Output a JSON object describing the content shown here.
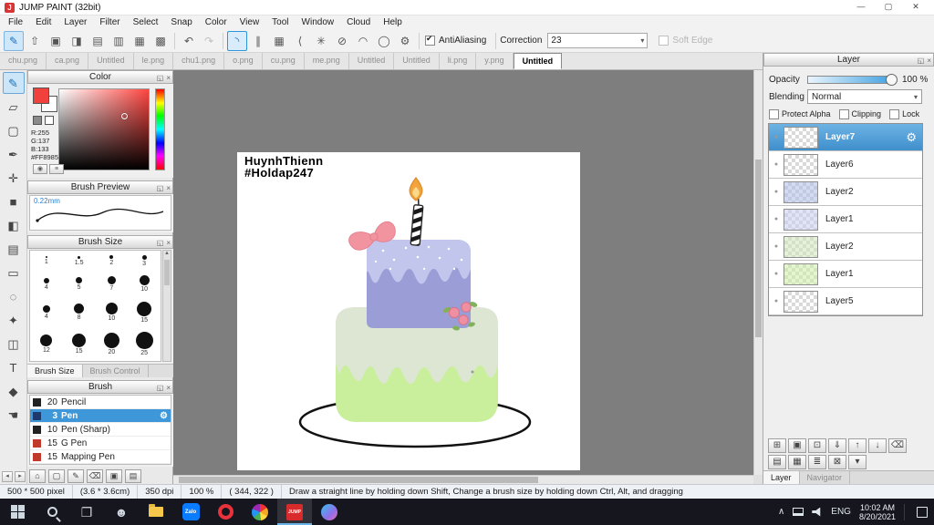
{
  "colors": {
    "accent": "#2f96dc",
    "canvas-bg": "#7e7e7e",
    "taskbar-bg": "#16161f",
    "cake-green": "#c9ef9c",
    "cake-sage": "#dde6d2",
    "cake-lavender": "#9b9ed6",
    "cake-lavender-light": "#c2c5ec",
    "bow-pink": "#f2949f",
    "flame-orange": "#f2a33c",
    "flame-inner": "#fbd98b",
    "rose-pink": "#ee8fa2",
    "leaf-green": "#83b05c",
    "picked-color": "#FF8985"
  },
  "ui": {
    "caret": "▾",
    "gear": "⚙",
    "check": "✔",
    "float_glyph": "◱",
    "close_glyph": "×",
    "eye_dot": "●",
    "scroll_up": "▲",
    "scroll_down": "▼"
  },
  "titlebar": {
    "title": "JUMP PAINT (32bit)",
    "icon_letter": "J",
    "minimize": "—",
    "maximize": "▢",
    "close": "✕"
  },
  "menubar": {
    "items": [
      "File",
      "Edit",
      "Layer",
      "Filter",
      "Select",
      "Snap",
      "Color",
      "View",
      "Tool",
      "Window",
      "Cloud",
      "Help"
    ]
  },
  "toolbar": {
    "file_buttons": [
      {
        "name": "paint-icon",
        "glyph": "✎",
        "accent": true
      },
      {
        "name": "upload-icon",
        "glyph": "⇧"
      },
      {
        "name": "monitor-icon",
        "glyph": "▣"
      },
      {
        "name": "message-icon",
        "glyph": "◨"
      },
      {
        "name": "save-icon",
        "glyph": "▤"
      },
      {
        "name": "export-icon",
        "glyph": "▥"
      },
      {
        "name": "print-icon",
        "glyph": "▦"
      },
      {
        "name": "table-icon",
        "glyph": "▩"
      }
    ],
    "undo_glyph": "↶",
    "redo_glyph": "↷",
    "snap_buttons": [
      {
        "name": "brush-mode-icon",
        "glyph": "◝",
        "selected": true
      },
      {
        "name": "parallel-snap-icon",
        "glyph": "∥"
      },
      {
        "name": "grid-snap-icon",
        "glyph": "▦"
      },
      {
        "name": "vanishing-snap-icon",
        "glyph": "⟨"
      },
      {
        "name": "cross-snap-icon",
        "glyph": "✳"
      },
      {
        "name": "snap-off-icon",
        "glyph": "⊘"
      },
      {
        "name": "curve-snap-icon",
        "glyph": "◠"
      },
      {
        "name": "ellipse-snap-icon",
        "glyph": "◯"
      },
      {
        "name": "snap-settings-icon",
        "glyph": "⚙"
      }
    ],
    "antialiasing_label": "AntiAliasing",
    "correction_label": "Correction",
    "correction_value": "23",
    "soft_edge_label": "Soft Edge"
  },
  "tabbar": {
    "tabs": [
      {
        "label": "chu.png"
      },
      {
        "label": "ca.png"
      },
      {
        "label": "Untitled"
      },
      {
        "label": "le.png"
      },
      {
        "label": "chu1.png"
      },
      {
        "label": "o.png"
      },
      {
        "label": "cu.png"
      },
      {
        "label": "me.png"
      },
      {
        "label": "Untitled"
      },
      {
        "label": "Untitled"
      },
      {
        "label": "li.png"
      },
      {
        "label": "y.png"
      },
      {
        "label": "Untitled",
        "active": true
      }
    ]
  },
  "toolstrip": {
    "tools": [
      {
        "name": "pen-tool",
        "glyph": "✎",
        "selected": true
      },
      {
        "name": "eraser-tool",
        "glyph": "▱"
      },
      {
        "name": "select-rect-tool",
        "glyph": "▢"
      },
      {
        "name": "nib-tool",
        "glyph": "✒"
      },
      {
        "name": "move-tool",
        "glyph": "✛"
      },
      {
        "name": "fill-rect-tool",
        "glyph": "■"
      },
      {
        "name": "bucket-tool",
        "glyph": "◧"
      },
      {
        "name": "gradient-tool",
        "glyph": "▤"
      },
      {
        "name": "marquee-tool",
        "glyph": "▭"
      },
      {
        "name": "lasso-tool",
        "glyph": "◌"
      },
      {
        "name": "magic-wand-tool",
        "glyph": "✦"
      },
      {
        "name": "divide-tool",
        "glyph": "◫"
      },
      {
        "name": "text-tool",
        "glyph": "T"
      },
      {
        "name": "eyedropper-tool",
        "glyph": "◆"
      },
      {
        "name": "hand-tool",
        "glyph": "☚"
      }
    ]
  },
  "color_panel": {
    "title": "Color",
    "r": "R:255",
    "g": "G:137",
    "b": "B:133",
    "hex": "#FF8985"
  },
  "brush_preview": {
    "title": "Brush Preview",
    "size_label": "0.22mm"
  },
  "brush_size": {
    "title": "Brush Size",
    "items": [
      {
        "label": "1",
        "dot": 2
      },
      {
        "label": "1.5",
        "dot": 3
      },
      {
        "label": "2",
        "dot": 4
      },
      {
        "label": "3",
        "dot": 5
      },
      {
        "label": "4",
        "dot": 6
      },
      {
        "label": "5",
        "dot": 7
      },
      {
        "label": "7",
        "dot": 9
      },
      {
        "label": "10",
        "dot": 11
      },
      {
        "label": "4",
        "dot": 8
      },
      {
        "label": "8",
        "dot": 11
      },
      {
        "label": "10",
        "dot": 13
      },
      {
        "label": "15",
        "dot": 16
      },
      {
        "label": "12",
        "dot": 13
      },
      {
        "label": "15",
        "dot": 15
      },
      {
        "label": "20",
        "dot": 17
      },
      {
        "label": "25",
        "dot": 19
      }
    ],
    "tabs": [
      "Brush Size",
      "Brush Control"
    ]
  },
  "brush_panel": {
    "title": "Brush",
    "items": [
      {
        "size": "20",
        "name": "Pencil",
        "chip": "#222222"
      },
      {
        "size": "3",
        "name": "Pen",
        "chip": "#1c3a6e",
        "selected": true
      },
      {
        "size": "10",
        "name": "Pen (Sharp)",
        "chip": "#222222"
      },
      {
        "size": "15",
        "name": "G Pen",
        "chip": "#c0392b"
      },
      {
        "size": "15",
        "name": "Mapping Pen",
        "chip": "#c0392b"
      }
    ],
    "footer_buttons": [
      {
        "name": "home-icon",
        "glyph": "⌂"
      },
      {
        "name": "new-brush-icon",
        "glyph": "▢"
      },
      {
        "name": "edit-brush-icon",
        "glyph": "✎"
      },
      {
        "name": "delete-brush-icon",
        "glyph": "⌫"
      },
      {
        "name": "brush-folder-icon",
        "glyph": "▣"
      },
      {
        "name": "brush-list-icon",
        "glyph": "▤"
      }
    ]
  },
  "canvas": {
    "signature_line1": "HuynhThienn",
    "signature_line2": "#Holdap247"
  },
  "layer_panel": {
    "title": "Layer",
    "opacity_label": "Opacity",
    "opacity_value": "100 %",
    "blending_label": "Blending",
    "blending_value": "Normal",
    "checkboxes": [
      "Protect Alpha",
      "Clipping",
      "Lock"
    ],
    "layers": [
      {
        "name": "Layer7",
        "selected": true
      },
      {
        "name": "Layer6"
      },
      {
        "name": "Layer2",
        "tint": "#aebde8"
      },
      {
        "name": "Layer1",
        "tint": "#c8cdf0"
      },
      {
        "name": "Layer2",
        "tint": "#cfe6b8"
      },
      {
        "name": "Layer1",
        "tint": "#cdeea6"
      },
      {
        "name": "Layer5"
      }
    ],
    "buttons_row1": [
      {
        "name": "add-layer-icon",
        "glyph": "⊞"
      },
      {
        "name": "add-folder-icon",
        "glyph": "▣"
      },
      {
        "name": "duplicate-layer-icon",
        "glyph": "⊡"
      },
      {
        "name": "merge-down-icon",
        "glyph": "⇓"
      },
      {
        "name": "move-layer-up-icon",
        "glyph": "↑"
      },
      {
        "name": "move-layer-down-icon",
        "glyph": "↓"
      },
      {
        "name": "delete-layer-icon",
        "glyph": "⌫"
      }
    ],
    "buttons_row2": [
      {
        "name": "mask-icon",
        "glyph": "▤"
      },
      {
        "name": "onion-skin-icon",
        "glyph": "▦"
      },
      {
        "name": "layer-list-icon",
        "glyph": "≣"
      },
      {
        "name": "clear-layer-icon",
        "glyph": "⊠"
      },
      {
        "name": "panel-menu-icon",
        "glyph": "▾"
      }
    ],
    "bottom_tabs": [
      "Layer",
      "Navigator"
    ]
  },
  "status_bar": {
    "segments": [
      "500 * 500 pixel",
      "(3.6 * 3.6cm)",
      "350 dpi",
      "100 %",
      "( 344, 322 )"
    ],
    "hint": "Draw a straight line by holding down Shift, Change a brush size by holding down Ctrl, Alt, and dragging"
  },
  "taskbar": {
    "zalo_label": "Zalo",
    "jump_label": "JUMP",
    "lang": "ENG",
    "time": "10:02 AM",
    "date": "8/20/2021"
  }
}
